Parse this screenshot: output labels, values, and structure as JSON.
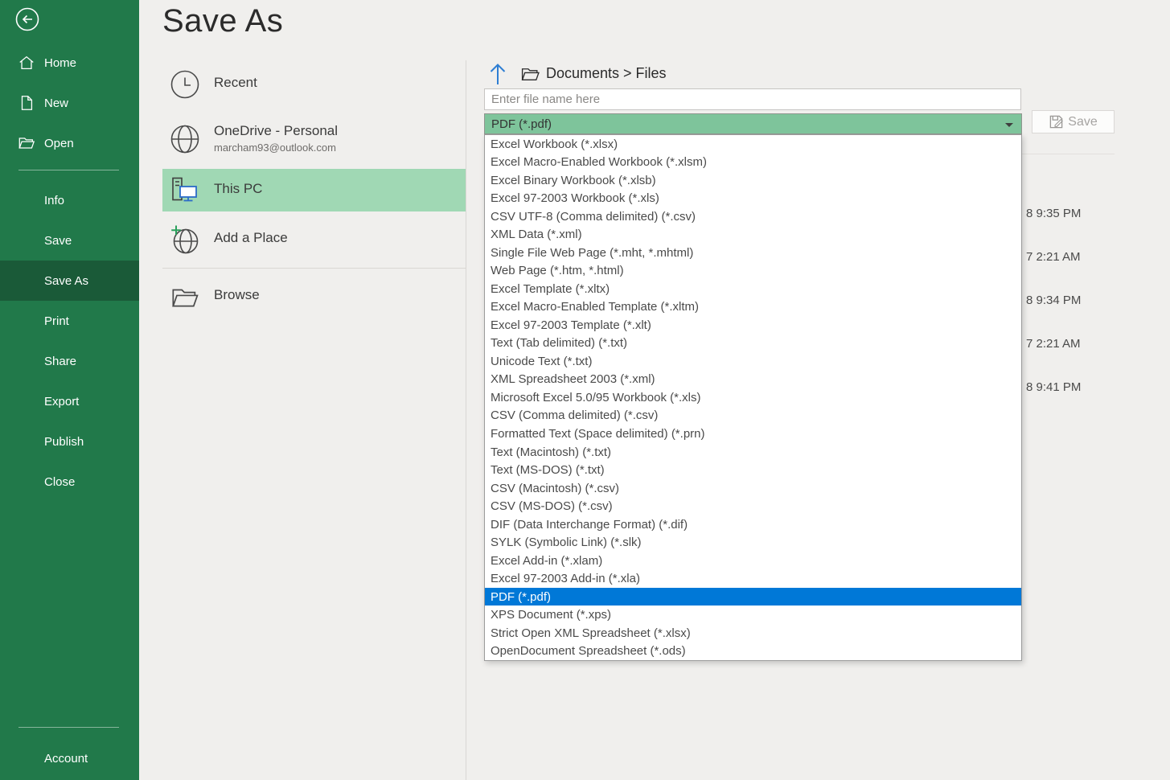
{
  "sidebar": {
    "nav_items": [
      {
        "label": "Home"
      },
      {
        "label": "New"
      },
      {
        "label": "Open"
      }
    ],
    "menu_items": [
      {
        "label": "Info"
      },
      {
        "label": "Save"
      },
      {
        "label": "Save As"
      },
      {
        "label": "Print"
      },
      {
        "label": "Share"
      },
      {
        "label": "Export"
      },
      {
        "label": "Publish"
      },
      {
        "label": "Close"
      }
    ],
    "selected_menu_item": "Save As",
    "account_label": "Account"
  },
  "page": {
    "title": "Save As"
  },
  "locations": {
    "items": [
      {
        "label": "Recent",
        "icon": "clock-icon"
      },
      {
        "label": "OneDrive - Personal",
        "sublabel": "marcham93@outlook.com",
        "icon": "globe-icon"
      },
      {
        "label": "This PC",
        "icon": "pc-icon",
        "selected": true
      },
      {
        "label": "Add a Place",
        "icon": "globe-plus-icon"
      },
      {
        "label": "Browse",
        "icon": "folder-icon"
      }
    ]
  },
  "main": {
    "breadcrumb": "Documents > Files",
    "filename_placeholder": "Enter file name here",
    "filetype_value": "PDF (*.pdf)",
    "save_button_label": "Save",
    "dropdown_highlighted": "PDF (*.pdf)",
    "dropdown_options": [
      "Excel Workbook (*.xlsx)",
      "Excel Macro-Enabled Workbook (*.xlsm)",
      "Excel Binary Workbook (*.xlsb)",
      "Excel 97-2003 Workbook (*.xls)",
      "CSV UTF-8 (Comma delimited) (*.csv)",
      "XML Data (*.xml)",
      "Single File Web Page (*.mht, *.mhtml)",
      "Web Page (*.htm, *.html)",
      "Excel Template (*.xltx)",
      "Excel Macro-Enabled Template (*.xltm)",
      "Excel 97-2003 Template (*.xlt)",
      "Text (Tab delimited) (*.txt)",
      "Unicode Text (*.txt)",
      "XML Spreadsheet 2003 (*.xml)",
      "Microsoft Excel 5.0/95 Workbook (*.xls)",
      "CSV (Comma delimited) (*.csv)",
      "Formatted Text (Space delimited) (*.prn)",
      "Text (Macintosh) (*.txt)",
      "Text (MS-DOS) (*.txt)",
      "CSV (Macintosh) (*.csv)",
      "CSV (MS-DOS) (*.csv)",
      "DIF (Data Interchange Format) (*.dif)",
      "SYLK (Symbolic Link) (*.slk)",
      "Excel Add-in (*.xlam)",
      "Excel 97-2003 Add-in (*.xla)",
      "PDF (*.pdf)",
      "XPS Document (*.xps)",
      "Strict Open XML Spreadsheet (*.xlsx)",
      "OpenDocument Spreadsheet (*.ods)"
    ],
    "file_times": [
      "8 9:35 PM",
      "7 2:21 AM",
      "8 9:34 PM",
      "7 2:21 AM",
      "8 9:41 PM"
    ]
  },
  "colors": {
    "sidebar_green": "#21794a",
    "sidebar_selected_green": "#1a5a38",
    "location_selected_green": "#a0d8b4",
    "filetype_header_green": "#7ec49b",
    "highlight_blue": "#0078d7",
    "background": "#f0efed"
  }
}
